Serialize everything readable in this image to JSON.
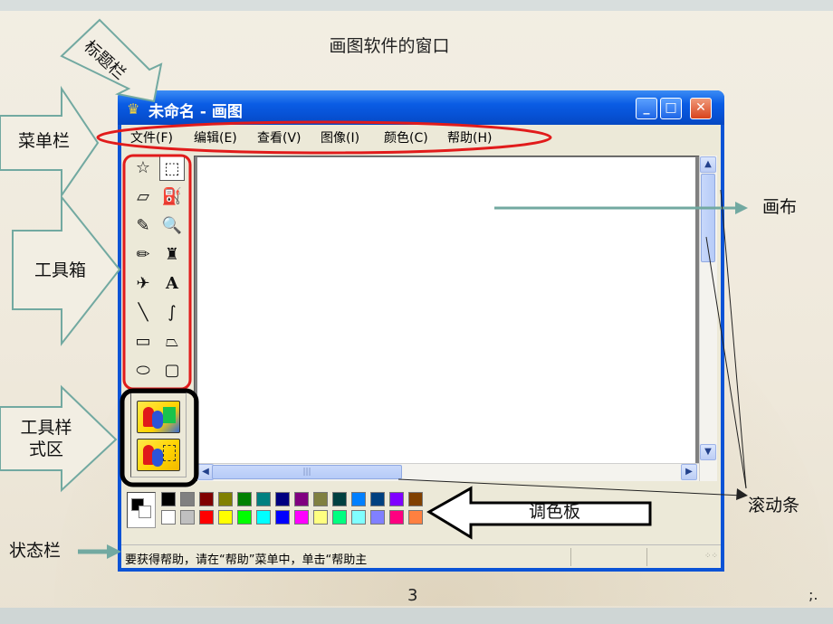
{
  "slide": {
    "title": "画图软件的窗口",
    "page_number": "3",
    "corner_mark": ";."
  },
  "window": {
    "title": "未命名 - 画图",
    "buttons": {
      "minimize": "_",
      "maximize": "□",
      "close": "✕"
    },
    "icon": "paint-app-icon"
  },
  "menu": {
    "items": [
      {
        "label": "文件(F)"
      },
      {
        "label": "编辑(E)"
      },
      {
        "label": "查看(V)"
      },
      {
        "label": "图像(I)"
      },
      {
        "label": "颜色(C)"
      },
      {
        "label": "帮助(H)"
      }
    ]
  },
  "toolbox": {
    "tools": [
      {
        "name": "free-select",
        "icon": "☆"
      },
      {
        "name": "rect-select",
        "icon": "⬚"
      },
      {
        "name": "eraser",
        "icon": "▱"
      },
      {
        "name": "fill-bucket",
        "icon": "⛽"
      },
      {
        "name": "color-picker",
        "icon": "✎"
      },
      {
        "name": "magnifier",
        "icon": "🔍"
      },
      {
        "name": "pencil",
        "icon": "✏"
      },
      {
        "name": "brush",
        "icon": "♜"
      },
      {
        "name": "airbrush",
        "icon": "✈"
      },
      {
        "name": "text",
        "icon": "A"
      },
      {
        "name": "line",
        "icon": "╲"
      },
      {
        "name": "curve",
        "icon": "∫"
      },
      {
        "name": "rectangle",
        "icon": "▭"
      },
      {
        "name": "polygon",
        "icon": "⏢"
      },
      {
        "name": "ellipse",
        "icon": "⬭"
      },
      {
        "name": "rounded-rect",
        "icon": "▢"
      }
    ],
    "selected": "rect-select"
  },
  "palette": {
    "row1": [
      "#000000",
      "#808080",
      "#800000",
      "#808000",
      "#008000",
      "#008080",
      "#000080",
      "#800080",
      "#808040",
      "#004040",
      "#0080ff",
      "#004080",
      "#8000ff",
      "#804000"
    ],
    "row2": [
      "#ffffff",
      "#c0c0c0",
      "#ff0000",
      "#ffff00",
      "#00ff00",
      "#00ffff",
      "#0000ff",
      "#ff00ff",
      "#ffff80",
      "#00ff80",
      "#80ffff",
      "#8080ff",
      "#ff0080",
      "#ff8040"
    ],
    "foreground": "#000000",
    "background": "#ffffff"
  },
  "statusbar": {
    "text": "要获得帮助，请在“帮助”菜单中，单击“帮助主"
  },
  "annotations": {
    "title_bar": "标题栏",
    "menu_bar": "菜单栏",
    "toolbox": "工具箱",
    "tool_style_area": "工具样式区",
    "canvas": "画布",
    "scrollbar": "滚动条",
    "palette": "调色板",
    "status_bar": "状态栏"
  },
  "colors": {
    "highlight_red": "#e11b1b",
    "arrow_teal": "#72a9a1",
    "xp_blue": "#0752d6"
  }
}
